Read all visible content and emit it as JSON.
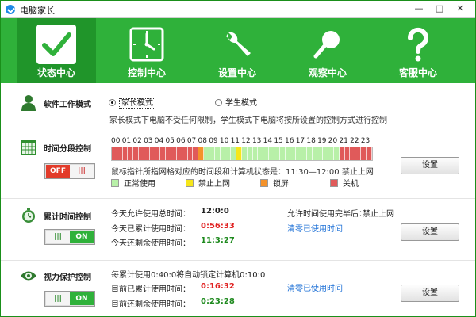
{
  "window": {
    "title": "电脑家长",
    "buttons": {
      "minimize": "—",
      "maximize": "□",
      "close": "✕"
    }
  },
  "nav": {
    "items": [
      {
        "label": "状态中心",
        "icon": "check-icon",
        "active": true
      },
      {
        "label": "控制中心",
        "icon": "clock-icon",
        "active": false
      },
      {
        "label": "设置中心",
        "icon": "wrench-icon",
        "active": false
      },
      {
        "label": "观察中心",
        "icon": "magnifier-icon",
        "active": false
      },
      {
        "label": "客服中心",
        "icon": "question-icon",
        "active": false
      }
    ]
  },
  "mode": {
    "title": "软件工作模式",
    "option_parent": "家长模式",
    "option_student": "学生模式",
    "selected": "家长模式",
    "description": "家长模式下电脑不受任何限制，学生模式下电脑将按所设置的控制方式进行控制"
  },
  "schedule": {
    "title": "时间分段控制",
    "toggle_off": "OFF",
    "toggle_handle": "|||",
    "hours": [
      "00",
      "01",
      "02",
      "03",
      "04",
      "05",
      "06",
      "07",
      "08",
      "09",
      "10",
      "11",
      "12",
      "13",
      "14",
      "15",
      "16",
      "17",
      "18",
      "19",
      "20",
      "21",
      "22",
      "23"
    ],
    "status_text": "鼠标指针所指网格对应的时间段和计算机状态是：11:30—12:00 禁止上网",
    "set_label": "设置",
    "legend": [
      {
        "label": "正常使用",
        "color": "#b8f0a8"
      },
      {
        "label": "禁止上网",
        "color": "#f6e61a"
      },
      {
        "label": "锁屏",
        "color": "#f4922a"
      },
      {
        "label": "关机",
        "color": "#e05a5a"
      }
    ],
    "slots": [
      "shutdown",
      "shutdown",
      "shutdown",
      "shutdown",
      "shutdown",
      "shutdown",
      "shutdown",
      "shutdown",
      "shutdown",
      "shutdown",
      "shutdown",
      "shutdown",
      "shutdown",
      "shutdown",
      "shutdown",
      "shutdown",
      "lock",
      "normal",
      "normal",
      "normal",
      "normal",
      "normal",
      "normal",
      "noweb",
      "normal",
      "normal",
      "normal",
      "normal",
      "normal",
      "normal",
      "normal",
      "normal",
      "normal",
      "normal",
      "normal",
      "normal",
      "normal",
      "normal",
      "normal",
      "normal",
      "normal",
      "normal",
      "shutdown",
      "shutdown",
      "shutdown",
      "shutdown",
      "shutdown",
      "shutdown"
    ]
  },
  "cumulative": {
    "title": "累计时间控制",
    "toggle_handle": "|||",
    "toggle_on": "ON",
    "allowed_label": "今天允许使用总时间：",
    "allowed_value": "12:0:0",
    "used_label": "今天已累计使用时间：",
    "used_value": "0:56:33",
    "remain_label": "今天还剩余使用时间：",
    "remain_value": "11:3:27",
    "after_label": "允许时间使用完毕后：",
    "after_value": "禁止上网",
    "clear_link": "清零已使用时间",
    "set_label": "设置"
  },
  "vision": {
    "title": "视力保护控制",
    "toggle_handle": "|||",
    "toggle_on": "ON",
    "rule_text": "每累计使用0:40:0将自动锁定计算机0:10:0",
    "used_label": "目前已累计使用时间：",
    "used_value": "0:16:32",
    "remain_label": "目前还剩余使用时间：",
    "remain_value": "0:23:28",
    "clear_link": "清零已使用时间",
    "set_label": "设置"
  }
}
